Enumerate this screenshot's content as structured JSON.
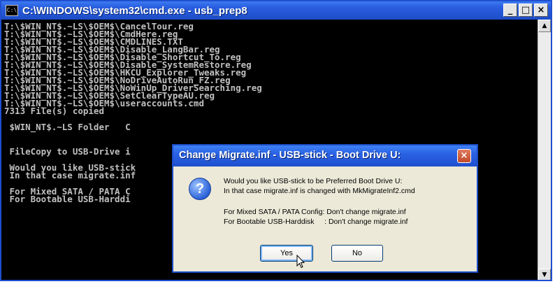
{
  "window": {
    "title": "C:\\WINDOWS\\system32\\cmd.exe - usb_prep8",
    "icon_text": "C:\\",
    "controls": [
      "_",
      "□",
      "×"
    ]
  },
  "console": {
    "lines": [
      "T:\\$WIN_NT$.~LS\\$OEM$\\CancelTour.reg",
      "T:\\$WIN_NT$.~LS\\$OEM$\\CmdHere.reg",
      "T:\\$WIN_NT$.~LS\\$OEM$\\CMDLINES.TXT",
      "T:\\$WIN_NT$.~LS\\$OEM$\\Disable_LangBar.reg",
      "T:\\$WIN_NT$.~LS\\$OEM$\\Disable_Shortcut_To.reg",
      "T:\\$WIN_NT$.~LS\\$OEM$\\Disable_SystemRestore.reg",
      "T:\\$WIN_NT$.~LS\\$OEM$\\HKCU_Explorer_Tweaks.reg",
      "T:\\$WIN_NT$.~LS\\$OEM$\\NoDriveAutoRun_FZ.reg",
      "T:\\$WIN_NT$.~LS\\$OEM$\\NoWinUp_DriverSearching.reg",
      "T:\\$WIN_NT$.~LS\\$OEM$\\SetClearTypeAU.reg",
      "T:\\$WIN_NT$.~LS\\$OEM$\\useraccounts.cmd",
      "7313 File(s) copied"
    ],
    "folder_line": " $WIN_NT$.~LS Folder   C",
    "filecopy_line": " FileCopy to USB-Drive i",
    "would_line_1": " Would you like USB-stick",
    "would_line_2": " In that case migrate.inf",
    "mixed_line_1": " For Mixed SATA / PATA C",
    "mixed_line_2": " For Bootable USB-Harddi"
  },
  "dialog": {
    "title": "Change Migrate.inf - USB-stick - Boot Drive U:",
    "close_label": "×",
    "icon_glyph": "?",
    "message_1": "Would you like USB-stick to be Preferred Boot Drive U:",
    "message_2": "In that case migrate.inf is changed with MkMigrateInf2.cmd",
    "message_3": "For Mixed SATA / PATA Config: Don't change migrate.inf",
    "message_4": "For Bootable USB-Harddisk     : Don't change migrate.inf",
    "yes_label": "Yes",
    "no_label": "No"
  },
  "colors": {
    "titlebar_blue": "#2a5fe0",
    "console_bg": "#000000",
    "console_text": "#c0c0c0",
    "dialog_bg": "#ece9d8"
  }
}
